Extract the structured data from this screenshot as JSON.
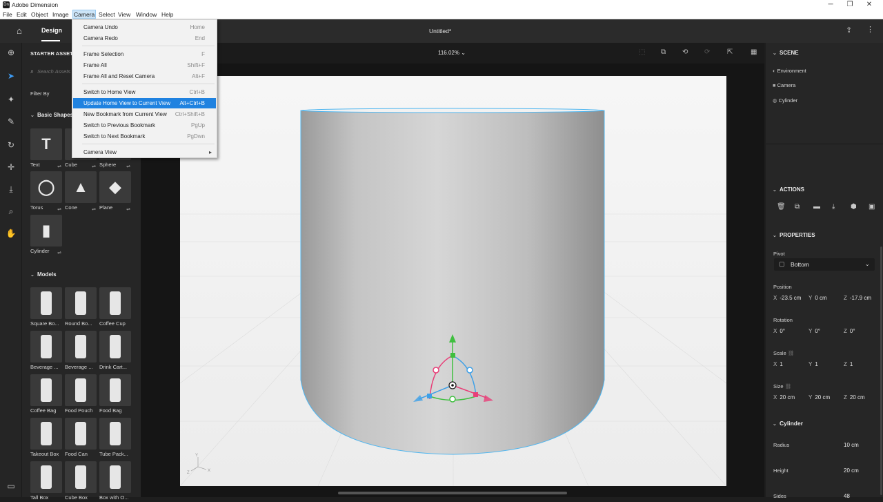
{
  "window": {
    "title": "Adobe Dimension",
    "app_icon": "Dn",
    "controls": {
      "minimize": "─",
      "restore": "❐",
      "close": "✕"
    }
  },
  "menubar": [
    "File",
    "Edit",
    "Object",
    "Image",
    "Camera",
    "Select",
    "View",
    "Window",
    "Help"
  ],
  "topbar": {
    "design_tab": "Design",
    "doc_title": "Untitled*",
    "zoom": "116.02%"
  },
  "camera_menu": {
    "items": [
      {
        "label": "Camera Undo",
        "shortcut": "Home"
      },
      {
        "label": "Camera Redo",
        "shortcut": "End"
      },
      {
        "label": "Frame Selection",
        "shortcut": "F"
      },
      {
        "label": "Frame All",
        "shortcut": "Shift+F"
      },
      {
        "label": "Frame All and Reset Camera",
        "shortcut": "Alt+F"
      },
      {
        "label": "Switch to Home View",
        "shortcut": "Ctrl+B"
      },
      {
        "label": "Update Home View to Current View",
        "shortcut": "Alt+Ctrl+B"
      },
      {
        "label": "New Bookmark from Current View",
        "shortcut": "Ctrl+Shift+B"
      },
      {
        "label": "Switch to Previous Bookmark",
        "shortcut": "PgUp"
      },
      {
        "label": "Switch to Next Bookmark",
        "shortcut": "PgDwn"
      },
      {
        "label": "Camera View",
        "shortcut": "▸"
      }
    ],
    "highlighted_index": 6
  },
  "assets": {
    "header": "STARTER ASSETS",
    "search_placeholder": "Search Assets",
    "filter_by": "Filter By",
    "basic_shapes_title": "Basic Shapes",
    "basic_shapes": [
      "Text",
      "Cube",
      "Sphere",
      "Torus",
      "Cone",
      "Plane",
      "Cylinder"
    ],
    "models_title": "Models",
    "models": [
      "Square Bo...",
      "Round Bo...",
      "Coffee Cup",
      "Beverage ...",
      "Beverage ...",
      "Drink Cart...",
      "Coffee Bag",
      "Food Pouch",
      "Food Bag",
      "Takeout Box",
      "Food Can",
      "Tube Pack...",
      "Tall Box",
      "Cube Box",
      "Box with O..."
    ]
  },
  "scene": {
    "title": "SCENE",
    "items": [
      "Environment",
      "Camera",
      "Cylinder"
    ]
  },
  "actions": {
    "title": "ACTIONS"
  },
  "properties": {
    "title": "PROPERTIES",
    "pivot_label": "Pivot",
    "pivot_value": "Bottom",
    "position_label": "Position",
    "position": {
      "x": "-23.5 cm",
      "y": "0 cm",
      "z": "-17.9 cm"
    },
    "rotation_label": "Rotation",
    "rotation": {
      "x": "0°",
      "y": "0°",
      "z": "0°"
    },
    "scale_label": "Scale",
    "scale": {
      "x": "1",
      "y": "1",
      "z": "1"
    },
    "size_label": "Size",
    "size": {
      "x": "20 cm",
      "y": "20 cm",
      "z": "20 cm"
    },
    "cylinder_title": "Cylinder",
    "radius_label": "Radius",
    "radius_value": "10 cm",
    "height_label": "Height",
    "height_value": "20 cm",
    "sides_label": "Sides",
    "sides_value": "48"
  },
  "axis_labels": {
    "x": "X",
    "y": "Y",
    "z": "Z"
  },
  "colors": {
    "accent": "#1f82e0",
    "selection_outline": "#4fb6f0",
    "gizmo_green": "#3fbf3f",
    "gizmo_blue": "#3da0e8",
    "gizmo_red": "#e83f78"
  }
}
